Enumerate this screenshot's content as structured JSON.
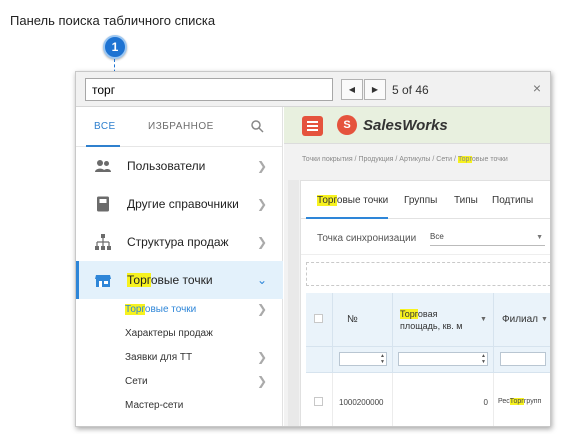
{
  "caption": "Панель поиска табличного списка",
  "marker": "1",
  "findbar": {
    "query": "торг",
    "counter": "5 of 46",
    "prev_icon": "triangle-left-icon",
    "next_icon": "triangle-right-icon",
    "close_label": "×"
  },
  "left_panel": {
    "tabs": {
      "all": "ВСЕ",
      "favorites": "ИЗБРАННОЕ"
    },
    "items": [
      {
        "label": "Пользователи",
        "icon": "users-icon"
      },
      {
        "label": "Другие справочники",
        "icon": "book-icon"
      },
      {
        "label": "Структура продаж",
        "icon": "hierarchy-icon"
      },
      {
        "label_hl": "Торг",
        "label_rest": "овые точки",
        "icon": "store-icon"
      }
    ],
    "sub_items": [
      {
        "hl": "Торг",
        "rest": "овые точки"
      },
      {
        "label": "Характеры продаж"
      },
      {
        "label": "Заявки для ТТ"
      },
      {
        "label": "Сети"
      },
      {
        "label": "Мастер-сети"
      }
    ]
  },
  "app": {
    "logo": "SalesWorks",
    "logo_mark": "S",
    "breadcrumb_pre": "Точки покрытия / Продукция / Артикулы / Сети / ",
    "breadcrumb_hl": "Торг",
    "breadcrumb_post": "овые точки",
    "content_tabs": {
      "first_hl": "Торг",
      "first_rest": "овые точки",
      "groups": "Группы",
      "types": "Типы",
      "subtypes": "Подтипы"
    },
    "sync_label": "Точка синхронизации",
    "sync_value": "Все",
    "grid": {
      "col_num": "№",
      "col_area_hl": "Торг",
      "col_area_rest": "овая",
      "col_area_line2": "площадь, кв. м",
      "col_branch": "Филиал",
      "row": {
        "num": "1000200000",
        "area": "0",
        "branch_pre": "Рес",
        "branch_hl": "Торг",
        "branch_post": "групп"
      }
    }
  },
  "colors": {
    "accent": "#2e86d8",
    "highlight": "#f7f21f",
    "brand": "#e5533d"
  }
}
